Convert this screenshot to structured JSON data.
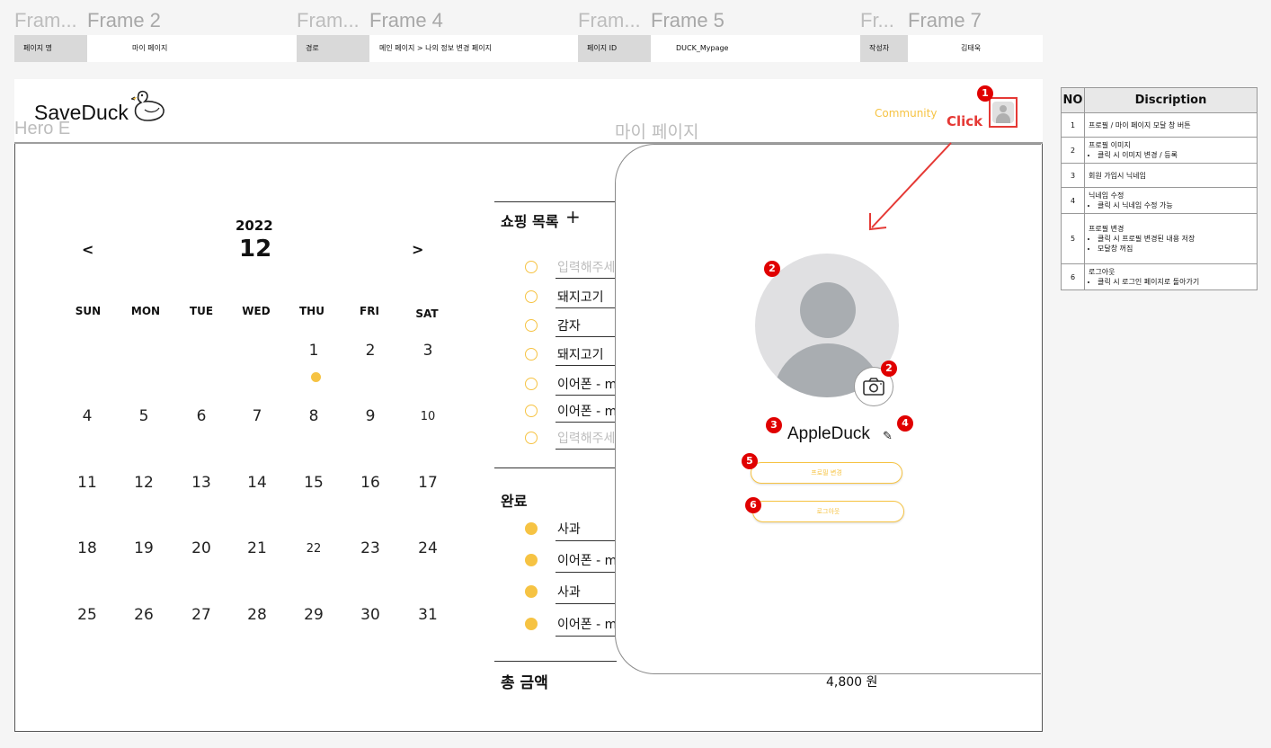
{
  "frames": [
    {
      "short": "Fram...",
      "full": "Frame 2"
    },
    {
      "short": "Fram...",
      "full": "Frame 4"
    },
    {
      "short": "Fram...",
      "full": "Frame 5"
    },
    {
      "short": "Fr...",
      "full": "Frame 7"
    }
  ],
  "info": {
    "page_name_key": "페이지 명",
    "page_name_val": "마이 페이지",
    "path_key": "경로",
    "path_val": "메인 페이지 > 나의 정보 변경 페이지",
    "page_id_key": "페이지 ID",
    "page_id_val": "DUCK_Mypage",
    "author_key": "작성자",
    "author_val": "김태욱"
  },
  "header": {
    "logo": "SaveDuck",
    "community": "Community",
    "click": "Click"
  },
  "labels": {
    "hero": "Hero E",
    "mypage": "마이 페이지"
  },
  "calendar": {
    "year": "2022",
    "month": "12",
    "prev": "<",
    "next": ">",
    "dow": [
      "SUN",
      "MON",
      "TUE",
      "WED",
      "THU",
      "FRI",
      "SAT"
    ],
    "weeks": [
      [
        "",
        "",
        "",
        "",
        "1",
        "2",
        "3"
      ],
      [
        "4",
        "5",
        "6",
        "7",
        "8",
        "9",
        "10"
      ],
      [
        "11",
        "12",
        "13",
        "14",
        "15",
        "16",
        "17"
      ],
      [
        "18",
        "19",
        "20",
        "21",
        "22",
        "23",
        "24"
      ],
      [
        "25",
        "26",
        "27",
        "28",
        "29",
        "30",
        "31"
      ]
    ]
  },
  "shopping": {
    "title": "쇼핑 목록",
    "add": "+",
    "items": [
      {
        "text": "입력해주세",
        "placeholder": true
      },
      {
        "text": "돼지고기",
        "placeholder": false
      },
      {
        "text": "감자",
        "placeholder": false
      },
      {
        "text": "돼지고기",
        "placeholder": false
      },
      {
        "text": " 이어폰  - m",
        "placeholder": false
      },
      {
        "text": " 이어폰  - m",
        "placeholder": false
      },
      {
        "text": "입력해주세",
        "placeholder": true
      }
    ]
  },
  "done": {
    "title": "완료",
    "items": [
      "사과",
      "이어폰  - m",
      "사과",
      "이어폰  - m"
    ]
  },
  "total": {
    "label": "총 금액",
    "value": "4,800 원"
  },
  "modal": {
    "nickname": "AppleDuck",
    "profile_change": "프로필 변경",
    "logout": "로그아웃"
  },
  "desc": {
    "head_no": "NO",
    "head_desc": "Discription",
    "rows": [
      {
        "no": "1",
        "title": "프로필 / 마이 페이지 모달 창 버튼",
        "bullets": []
      },
      {
        "no": "2",
        "title": "프로필 이미지",
        "bullets": [
          "클릭 시 이미지 변경 / 등록"
        ]
      },
      {
        "no": "3",
        "title": "회원 가입시 닉네임",
        "bullets": []
      },
      {
        "no": "4",
        "title": "닉네임 수정",
        "bullets": [
          "클릭 시 닉네임 수정 가능"
        ]
      },
      {
        "no": "5",
        "title": "프로필 변경",
        "bullets": [
          "클릭 시 프로필 변경된 내용 저장",
          "모달창 꺼짐"
        ]
      },
      {
        "no": "6",
        "title": "로그아웃",
        "bullets": [
          "클릭 시 로그인 페이지로 돌아가기"
        ]
      }
    ]
  },
  "badges": [
    "1",
    "2",
    "2",
    "3",
    "4",
    "5",
    "6"
  ],
  "colors": {
    "accent": "#f6c343",
    "annotation": "#e00000"
  }
}
